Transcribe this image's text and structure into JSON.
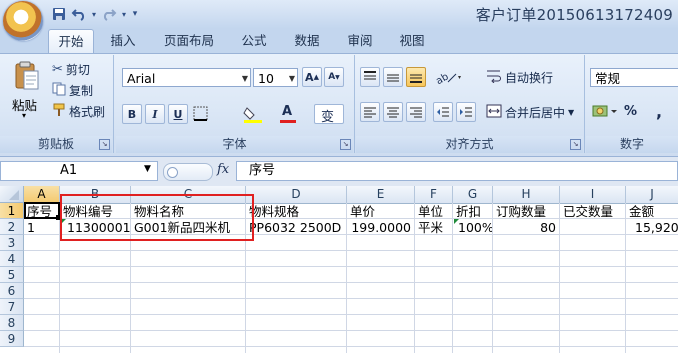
{
  "window": {
    "title": "客户订单20150613172409"
  },
  "quick_access": {
    "save_icon": "save-icon",
    "undo_icon": "undo-icon",
    "redo_icon": "redo-icon"
  },
  "tabs": [
    "开始",
    "插入",
    "页面布局",
    "公式",
    "数据",
    "审阅",
    "视图"
  ],
  "active_tab": "开始",
  "ribbon": {
    "clipboard": {
      "paste": "粘贴",
      "cut": "剪切",
      "copy": "复制",
      "format_painter": "格式刷",
      "label": "剪贴板"
    },
    "font": {
      "name": "Arial",
      "size": "10",
      "grow": "A",
      "shrink": "A",
      "bold": "B",
      "italic": "I",
      "underline": "U",
      "font_color": "A",
      "phonetic": "变",
      "label": "字体"
    },
    "alignment": {
      "wrap": "自动换行",
      "merge": "合并后居中",
      "label": "对齐方式"
    },
    "number": {
      "format": "常规",
      "percent": "%",
      "comma": ",",
      "label": "数字"
    }
  },
  "formula_bar": {
    "name_box": "A1",
    "fx": "fx",
    "content": "序号"
  },
  "columns": [
    "A",
    "B",
    "C",
    "D",
    "E",
    "F",
    "G",
    "H",
    "I",
    "J"
  ],
  "rows": [
    "1",
    "2",
    "3",
    "4",
    "5",
    "6",
    "7",
    "8",
    "9"
  ],
  "header_row": [
    "序号",
    "物料编号",
    "物料名称",
    "物料规格",
    "单价",
    "单位",
    "折扣",
    "订购数量",
    "已交数量",
    "金额"
  ],
  "data_row": [
    "1",
    "11300001",
    "G001新品四米机",
    "PP6032 2500D",
    "199.0000",
    "平米",
    "100%",
    "80",
    "",
    "15,920."
  ],
  "colors": {
    "highlight_box": "#e02020",
    "selected_header": "#f4c96e"
  }
}
